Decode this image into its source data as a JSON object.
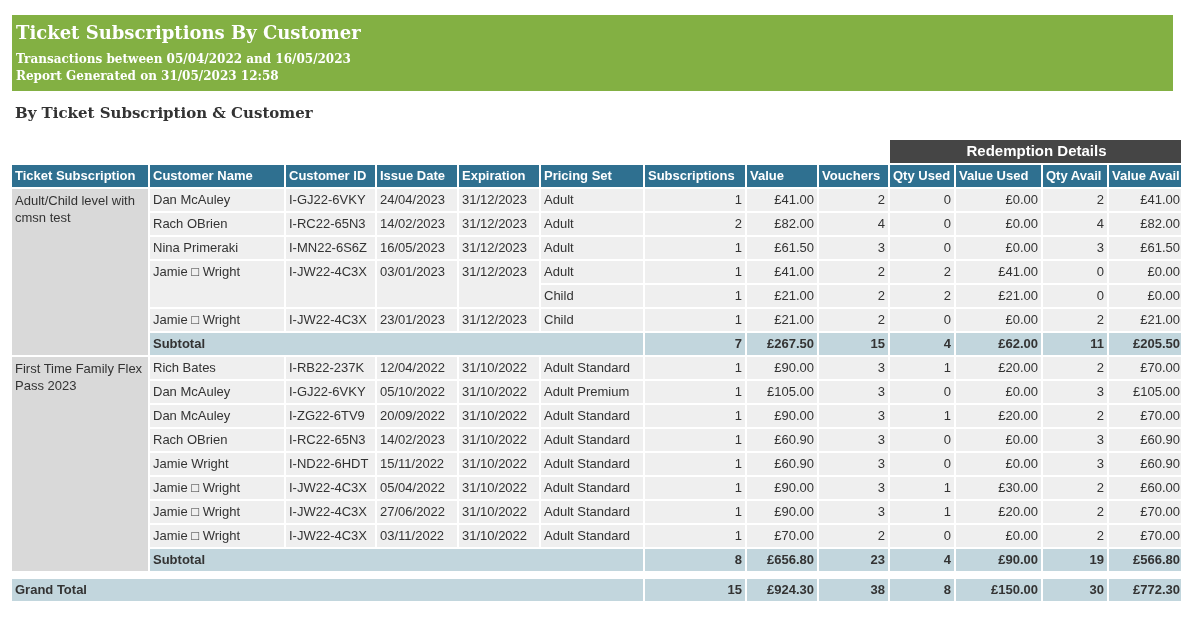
{
  "banner": {
    "title": "Ticket Subscriptions By Customer",
    "subtitles": [
      "Transactions between 05/04/2022 and 16/05/2023",
      "Report Generated on 31/05/2023 12:58"
    ]
  },
  "section_title": "By Ticket Subscription & Customer",
  "table": {
    "group_header": "Redemption Details",
    "columns": [
      "Ticket Subscription",
      "Customer Name",
      "Customer ID",
      "Issue Date",
      "Expiration",
      "Pricing Set",
      "Subscriptions",
      "Value",
      "Vouchers",
      "Qty Used",
      "Value Used",
      "Qty Avail",
      "Value Avail"
    ],
    "groups": [
      {
        "subscription": "Adult/Child level with cmsn test",
        "rows": [
          {
            "customer_name": "Dan McAuley",
            "customer_id": "I-GJ22-6VKY",
            "issue_date": "24/04/2023",
            "expiration": "31/12/2023",
            "lines": [
              {
                "pricing_set": "Adult",
                "values": [
                  "1",
                  "£41.00",
                  "2",
                  "0",
                  "£0.00",
                  "2",
                  "£41.00"
                ]
              }
            ]
          },
          {
            "customer_name": "Rach OBrien",
            "customer_id": "I-RC22-65N3",
            "issue_date": "14/02/2023",
            "expiration": "31/12/2023",
            "lines": [
              {
                "pricing_set": "Adult",
                "values": [
                  "2",
                  "£82.00",
                  "4",
                  "0",
                  "£0.00",
                  "4",
                  "£82.00"
                ]
              }
            ]
          },
          {
            "customer_name": "Nina Primeraki",
            "customer_id": "I-MN22-6S6Z",
            "issue_date": "16/05/2023",
            "expiration": "31/12/2023",
            "lines": [
              {
                "pricing_set": "Adult",
                "values": [
                  "1",
                  "£61.50",
                  "3",
                  "0",
                  "£0.00",
                  "3",
                  "£61.50"
                ]
              }
            ]
          },
          {
            "customer_name": "Jamie □ Wright",
            "customer_id": "I-JW22-4C3X",
            "issue_date": "03/01/2023",
            "expiration": "31/12/2023",
            "lines": [
              {
                "pricing_set": "Adult",
                "values": [
                  "1",
                  "£41.00",
                  "2",
                  "2",
                  "£41.00",
                  "0",
                  "£0.00"
                ]
              },
              {
                "pricing_set": "Child",
                "values": [
                  "1",
                  "£21.00",
                  "2",
                  "2",
                  "£21.00",
                  "0",
                  "£0.00"
                ]
              }
            ]
          },
          {
            "customer_name": "Jamie □ Wright",
            "customer_id": "I-JW22-4C3X",
            "issue_date": "23/01/2023",
            "expiration": "31/12/2023",
            "lines": [
              {
                "pricing_set": "Child",
                "values": [
                  "1",
                  "£21.00",
                  "2",
                  "0",
                  "£0.00",
                  "2",
                  "£21.00"
                ]
              }
            ]
          }
        ],
        "subtotal": {
          "label": "Subtotal",
          "values": [
            "7",
            "£267.50",
            "15",
            "4",
            "£62.00",
            "11",
            "£205.50"
          ]
        }
      },
      {
        "subscription": "First Time Family Flex Pass 2023",
        "rows": [
          {
            "customer_name": "Rich Bates",
            "customer_id": "I-RB22-237K",
            "issue_date": "12/04/2022",
            "expiration": "31/10/2022",
            "lines": [
              {
                "pricing_set": "Adult Standard",
                "values": [
                  "1",
                  "£90.00",
                  "3",
                  "1",
                  "£20.00",
                  "2",
                  "£70.00"
                ]
              }
            ]
          },
          {
            "customer_name": "Dan McAuley",
            "customer_id": "I-GJ22-6VKY",
            "issue_date": "05/10/2022",
            "expiration": "31/10/2022",
            "lines": [
              {
                "pricing_set": "Adult Premium",
                "values": [
                  "1",
                  "£105.00",
                  "3",
                  "0",
                  "£0.00",
                  "3",
                  "£105.00"
                ]
              }
            ]
          },
          {
            "customer_name": "Dan McAuley",
            "customer_id": "I-ZG22-6TV9",
            "issue_date": "20/09/2022",
            "expiration": "31/10/2022",
            "lines": [
              {
                "pricing_set": "Adult Standard",
                "values": [
                  "1",
                  "£90.00",
                  "3",
                  "1",
                  "£20.00",
                  "2",
                  "£70.00"
                ]
              }
            ]
          },
          {
            "customer_name": "Rach OBrien",
            "customer_id": "I-RC22-65N3",
            "issue_date": "14/02/2023",
            "expiration": "31/10/2022",
            "lines": [
              {
                "pricing_set": "Adult Standard",
                "values": [
                  "1",
                  "£60.90",
                  "3",
                  "0",
                  "£0.00",
                  "3",
                  "£60.90"
                ]
              }
            ]
          },
          {
            "customer_name": "Jamie Wright",
            "customer_id": "I-ND22-6HDT",
            "issue_date": "15/11/2022",
            "expiration": "31/10/2022",
            "lines": [
              {
                "pricing_set": "Adult Standard",
                "values": [
                  "1",
                  "£60.90",
                  "3",
                  "0",
                  "£0.00",
                  "3",
                  "£60.90"
                ]
              }
            ]
          },
          {
            "customer_name": "Jamie □ Wright",
            "customer_id": "I-JW22-4C3X",
            "issue_date": "05/04/2022",
            "expiration": "31/10/2022",
            "lines": [
              {
                "pricing_set": "Adult Standard",
                "values": [
                  "1",
                  "£90.00",
                  "3",
                  "1",
                  "£30.00",
                  "2",
                  "£60.00"
                ]
              }
            ]
          },
          {
            "customer_name": "Jamie □ Wright",
            "customer_id": "I-JW22-4C3X",
            "issue_date": "27/06/2022",
            "expiration": "31/10/2022",
            "lines": [
              {
                "pricing_set": "Adult Standard",
                "values": [
                  "1",
                  "£90.00",
                  "3",
                  "1",
                  "£20.00",
                  "2",
                  "£70.00"
                ]
              }
            ]
          },
          {
            "customer_name": "Jamie □ Wright",
            "customer_id": "I-JW22-4C3X",
            "issue_date": "03/11/2022",
            "expiration": "31/10/2022",
            "lines": [
              {
                "pricing_set": "Adult Standard",
                "values": [
                  "1",
                  "£70.00",
                  "2",
                  "0",
                  "£0.00",
                  "2",
                  "£70.00"
                ]
              }
            ]
          }
        ],
        "subtotal": {
          "label": "Subtotal",
          "values": [
            "8",
            "£656.80",
            "23",
            "4",
            "£90.00",
            "19",
            "£566.80"
          ]
        }
      }
    ],
    "grand_total": {
      "label": "Grand Total",
      "values": [
        "15",
        "£924.30",
        "38",
        "8",
        "£150.00",
        "30",
        "£772.30"
      ]
    }
  }
}
